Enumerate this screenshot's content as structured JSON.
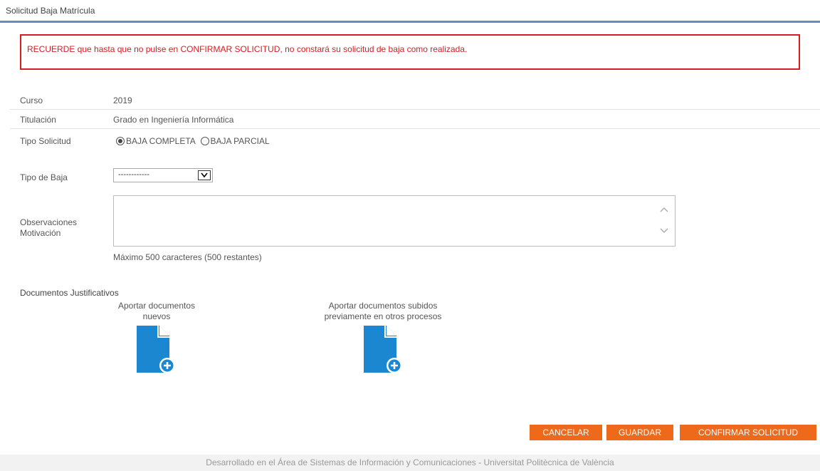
{
  "header": {
    "title": "Solicitud Baja Matrícula"
  },
  "alert": {
    "text": "RECUERDE que hasta que no pulse en CONFIRMAR SOLICITUD, no constará su solicitud de baja como realizada."
  },
  "fields": {
    "curso": {
      "label": "Curso",
      "value": "2019"
    },
    "titulacion": {
      "label": "Titulación",
      "value": "Grado en Ingeniería Informática"
    },
    "tipo_solicitud": {
      "label": "Tipo Solicitud",
      "options": [
        {
          "label": "BAJA COMPLETA",
          "checked": true
        },
        {
          "label": "BAJA PARCIAL",
          "checked": false
        }
      ]
    },
    "tipo_baja": {
      "label": "Tipo de Baja",
      "selected": "------------"
    },
    "observaciones": {
      "label_line1": "Observaciones",
      "label_line2": "Motivación",
      "value": "",
      "helper": "Máximo 500 caracteres (500 restantes)"
    }
  },
  "documentos": {
    "title": "Documentos Justificativos",
    "new_docs": {
      "line1": "Aportar documentos",
      "line2": "nuevos"
    },
    "previous_docs": {
      "line1": "Aportar documentos subidos",
      "line2": "previamente en otros procesos"
    }
  },
  "buttons": {
    "cancel": "CANCELAR",
    "save": "GUARDAR",
    "confirm": "CONFIRMAR SOLICITUD"
  },
  "footer": {
    "left": "Desarrollado en el Área de Sistemas de Información y Comunicaciones",
    "separator": "-",
    "right": "Universitat Politècnica de València"
  },
  "colors": {
    "accent_blue": "#5b8fc6",
    "alert_red": "#d41e24",
    "button_orange": "#ee6a1a",
    "doc_icon_blue": "#1a87d0"
  }
}
